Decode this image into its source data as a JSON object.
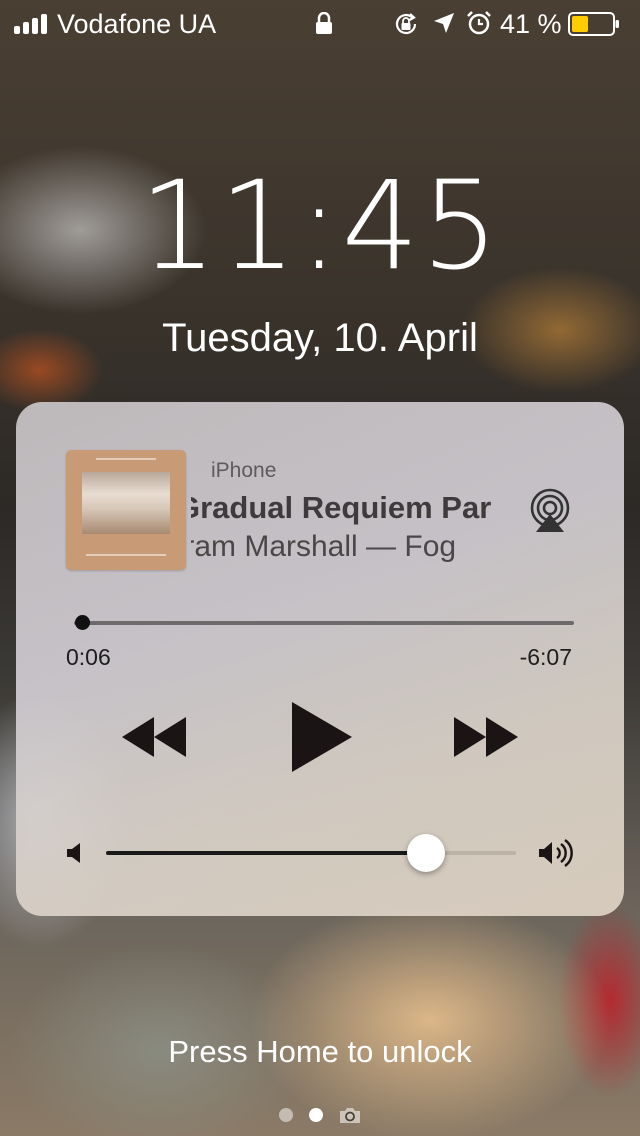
{
  "status_bar": {
    "carrier": "Vodafone UA",
    "signal_bars": 4,
    "battery_percent_text": "41 %",
    "battery_level": 0.41,
    "battery_color": "#FFCC00",
    "icons": [
      "lock-icon",
      "orientation-lock-icon",
      "location-arrow-icon",
      "alarm-clock-icon"
    ]
  },
  "lock_screen": {
    "time": "11:45",
    "date": "Tuesday, 10. April",
    "unlock_hint": "Press Home to unlock",
    "page_dots": [
      "dot",
      "dot-active",
      "camera-icon"
    ]
  },
  "now_playing": {
    "source": "iPhone",
    "title": "Gradual Requiem Par",
    "artist_album": "Iram Marshall — Fog",
    "elapsed": "0:06",
    "remaining": "-6:07",
    "progress": 0.016,
    "volume": 0.78,
    "controls": [
      "rewind-icon",
      "play-icon",
      "fast-forward-icon"
    ],
    "airplay_icon": "airplay-icon"
  }
}
